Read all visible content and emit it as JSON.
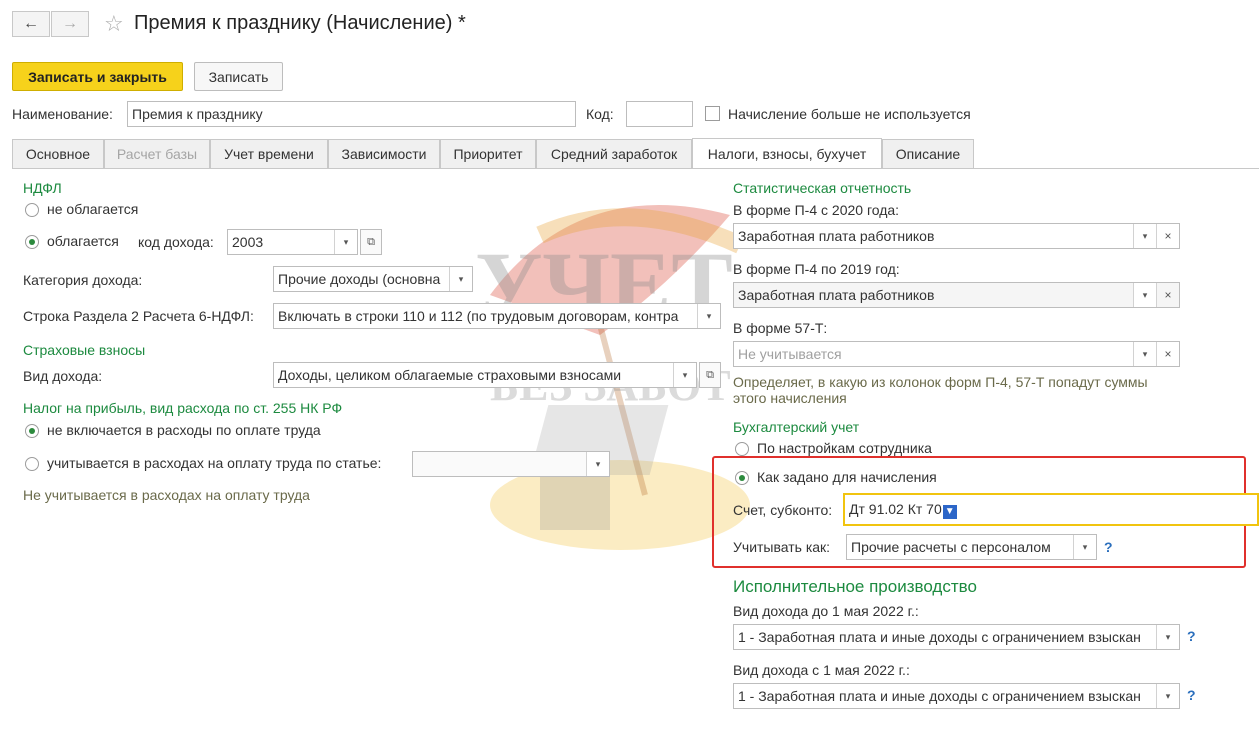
{
  "window": {
    "title": "Премия к празднику (Начисление) *"
  },
  "toolbar": {
    "save_close": "Записать и закрыть",
    "save": "Записать"
  },
  "header": {
    "name_label": "Наименование:",
    "name_value": "Премия к празднику",
    "code_label": "Код:",
    "code_value": "",
    "not_used_label": "Начисление больше не используется"
  },
  "tabs": [
    {
      "label": "Основное"
    },
    {
      "label": "Расчет базы"
    },
    {
      "label": "Учет времени"
    },
    {
      "label": "Зависимости"
    },
    {
      "label": "Приоритет"
    },
    {
      "label": "Средний заработок"
    },
    {
      "label": "Налоги, взносы, бухучет"
    },
    {
      "label": "Описание"
    }
  ],
  "ndfl": {
    "heading": "НДФЛ",
    "not_taxed": "не облагается",
    "taxed": "облагается",
    "income_code_label": "код дохода:",
    "income_code_value": "2003",
    "category_label": "Категория дохода:",
    "category_value": "Прочие доходы (основна",
    "line_label": "Строка Раздела 2 Расчета 6-НДФЛ:",
    "line_value": "Включать в строки 110 и 112 (по трудовым договорам, контра"
  },
  "insurance": {
    "heading": "Страховые взносы",
    "income_type_label": "Вид дохода:",
    "income_type_value": "Доходы, целиком облагаемые страховыми взносами"
  },
  "profit_tax": {
    "heading": "Налог на прибыль, вид расхода по ст. 255 НК РФ",
    "not_included": "не включается в расходы по оплате труда",
    "included": "учитывается в расходах на оплату труда по статье:",
    "article_value": "",
    "note": "Не учитывается в расходах на оплату труда"
  },
  "stats": {
    "heading": "Статистическая отчетность",
    "p4_2020_label": "В форме П-4 с 2020 года:",
    "p4_2020_value": "Заработная плата работников",
    "p4_2019_label": "В форме П-4 по 2019 год:",
    "p4_2019_value": "Заработная плата работников",
    "f57t_label": "В форме 57-Т:",
    "f57t_placeholder": "Не учитывается",
    "note_line1": "Определяет, в какую из колонок форм П-4, 57-Т попадут суммы",
    "note_line2": "этого начисления"
  },
  "accounting": {
    "heading": "Бухгалтерский учет",
    "by_employee": "По настройкам сотрудника",
    "as_set": "Как задано для начисления",
    "account_label": "Счет, субконто:",
    "account_value": "Дт 91.02 Кт 70",
    "account_marker": "▼",
    "record_as_label": "Учитывать как:",
    "record_as_value": "Прочие расчеты с персоналом",
    "help": "?"
  },
  "enforcement": {
    "heading": "Исполнительное производство",
    "before_label": "Вид дохода до 1 мая 2022 г.:",
    "before_value": "1 - Заработная плата и иные доходы с ограничением взыскан",
    "after_label": "Вид дохода с 1 мая 2022 г.:",
    "after_value": "1 - Заработная плата и иные доходы с ограничением взыскан",
    "help": "?"
  },
  "icons": {
    "back": "←",
    "forward": "→",
    "star": "☆",
    "dropdown": "▾",
    "clear": "×",
    "open": "⧉"
  },
  "watermark": {
    "line1": "УЧЕТ",
    "line2": "БЕЗ ЗАБОТ"
  },
  "colors": {
    "primary_button": "#f6d21b",
    "section_heading": "#1c8a3f",
    "highlight_frame": "#e0302c",
    "focus_frame": "#f1c40f"
  }
}
